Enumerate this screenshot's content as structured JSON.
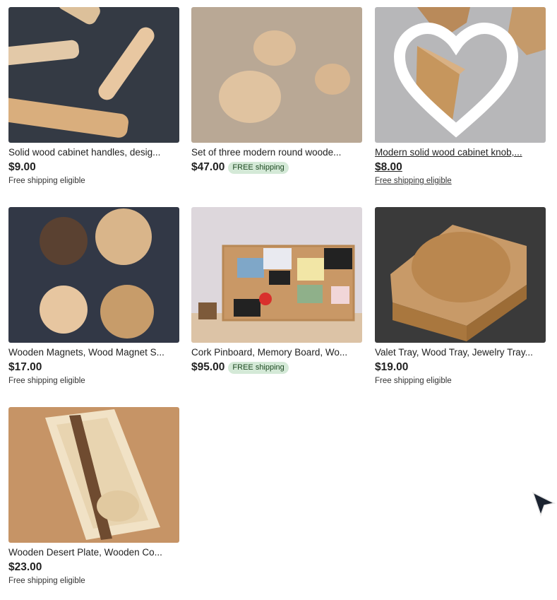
{
  "listings": [
    {
      "title": "Solid wood cabinet handles, desig...",
      "price": "$9.00",
      "badge": "",
      "shipping": "Free shipping eligible"
    },
    {
      "title": "Set of three modern round woode...",
      "price": "$47.00",
      "badge": "FREE shipping",
      "shipping": ""
    },
    {
      "title": "Modern solid wood cabinet knob,...",
      "price": "$8.00",
      "badge": "",
      "shipping": "Free shipping eligible"
    },
    {
      "title": "Wooden Magnets, Wood Magnet S...",
      "price": "$17.00",
      "badge": "",
      "shipping": "Free shipping eligible"
    },
    {
      "title": "Cork Pinboard, Memory Board, Wo...",
      "price": "$95.00",
      "badge": "FREE shipping",
      "shipping": ""
    },
    {
      "title": "Valet Tray, Wood Tray, Jewelry Tray...",
      "price": "$19.00",
      "badge": "",
      "shipping": "Free shipping eligible"
    },
    {
      "title": "Wooden Desert Plate, Wooden Co...",
      "price": "$23.00",
      "badge": "",
      "shipping": "Free shipping eligible"
    }
  ],
  "colors": {
    "badge_bg": "#d4e9d7",
    "badge_text": "#1f4a23",
    "text": "#222222"
  },
  "icons": {
    "favorite": "heart-outline-icon",
    "pointer": "mouse-cursor-icon"
  }
}
